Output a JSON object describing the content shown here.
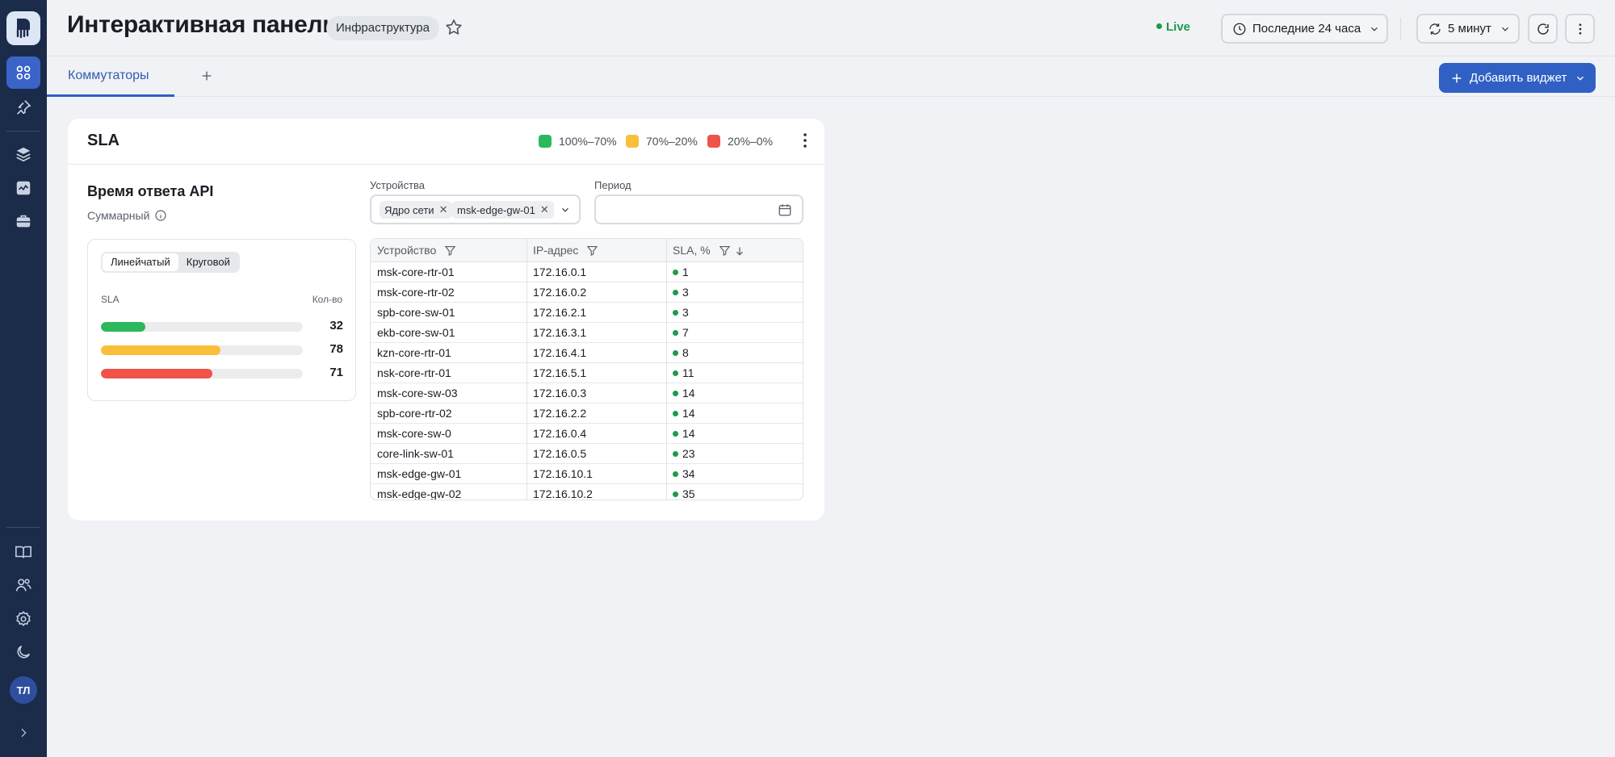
{
  "header": {
    "title": "Интерактивная панель",
    "tag": "Инфраструктура",
    "live": "Live",
    "time_range": "Последние 24 часа",
    "refresh_interval": "5 минут"
  },
  "tabs": {
    "active": "Коммутаторы",
    "add_widget": "Добавить виджет"
  },
  "sidebar": {
    "avatar": "ТЛ"
  },
  "widget": {
    "title": "SLA",
    "legend": [
      {
        "label": "100%–70%",
        "color": "#2bb95c"
      },
      {
        "label": "70%–20%",
        "color": "#f9bf3b"
      },
      {
        "label": "20%–0%",
        "color": "#ef5349"
      }
    ],
    "subtitle": "Время ответа API",
    "mode": "Суммарный",
    "mini": {
      "seg_line": "Линейчатый",
      "seg_pie": "Круговой",
      "col_sla": "SLA",
      "col_count": "Кол-во",
      "bars": [
        {
          "value": "32",
          "fill": 0.22,
          "color": "#2bb95c"
        },
        {
          "value": "78",
          "fill": 0.59,
          "color": "#f9bf3b"
        },
        {
          "value": "71",
          "fill": 0.55,
          "color": "#ef5349"
        }
      ]
    },
    "filters": {
      "devices_label": "Устройства",
      "period_label": "Период",
      "chips": [
        "Ядро сети",
        "msk-edge-gw-01"
      ]
    },
    "table": {
      "columns": [
        "Устройство",
        "IP-адрес",
        "SLA, %"
      ],
      "rows": [
        [
          "msk-core-rtr-01",
          "172.16.0.1",
          "1"
        ],
        [
          "msk-core-rtr-02",
          "172.16.0.2",
          "3"
        ],
        [
          "spb-core-sw-01",
          "172.16.2.1",
          "3"
        ],
        [
          "ekb-core-sw-01",
          "172.16.3.1",
          "7"
        ],
        [
          "kzn-core-rtr-01",
          "172.16.4.1",
          "8"
        ],
        [
          "nsk-core-rtr-01",
          "172.16.5.1",
          "11"
        ],
        [
          "msk-core-sw-03",
          "172.16.0.3",
          "14"
        ],
        [
          "spb-core-rtr-02",
          "172.16.2.2",
          "14"
        ],
        [
          "msk-core-sw-0",
          "172.16.0.4",
          "14"
        ],
        [
          "core-link-sw-01",
          "172.16.0.5",
          "23"
        ],
        [
          "msk-edge-gw-01",
          "172.16.10.1",
          "34"
        ],
        [
          "msk-edge-gw-02",
          "172.16.10.2",
          "35"
        ]
      ]
    }
  }
}
